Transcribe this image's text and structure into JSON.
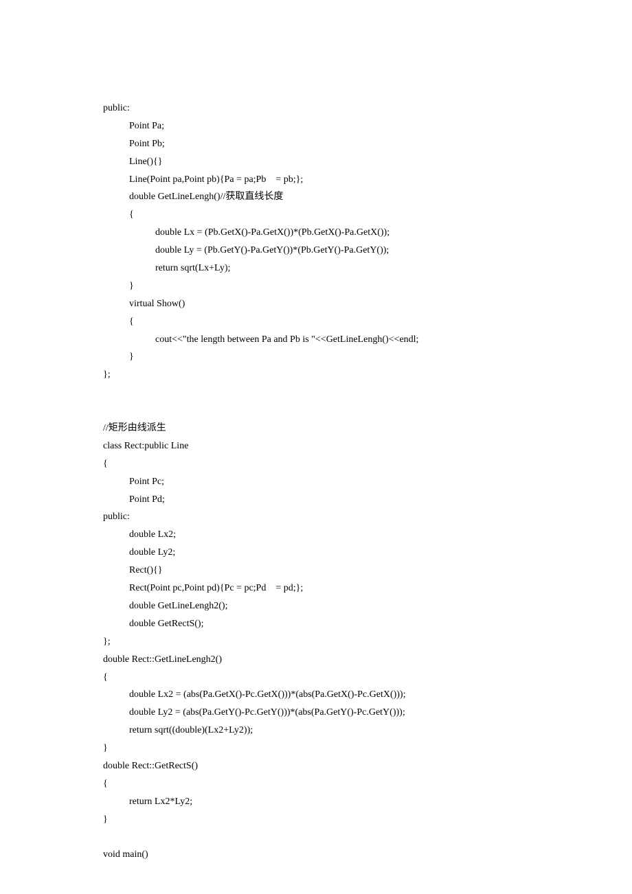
{
  "lines": [
    {
      "indent": 0,
      "text": "public:"
    },
    {
      "indent": 1,
      "text": "Point Pa;"
    },
    {
      "indent": 1,
      "text": "Point Pb;"
    },
    {
      "indent": 1,
      "text": "Line(){}"
    },
    {
      "indent": 1,
      "text": "Line(Point pa,Point pb){Pa = pa;Pb    = pb;};"
    },
    {
      "indent": 1,
      "text": "double GetLineLengh()//获取直线长度"
    },
    {
      "indent": 1,
      "text": "{"
    },
    {
      "indent": 2,
      "text": "double Lx = (Pb.GetX()-Pa.GetX())*(Pb.GetX()-Pa.GetX());"
    },
    {
      "indent": 2,
      "text": "double Ly = (Pb.GetY()-Pa.GetY())*(Pb.GetY()-Pa.GetY());"
    },
    {
      "indent": 2,
      "text": "return sqrt(Lx+Ly);"
    },
    {
      "indent": 1,
      "text": "}"
    },
    {
      "indent": 1,
      "text": "virtual Show()"
    },
    {
      "indent": 1,
      "text": "{"
    },
    {
      "indent": 2,
      "text": "cout<<\"the length between Pa and Pb is \"<<GetLineLengh()<<endl;"
    },
    {
      "indent": 1,
      "text": "}"
    },
    {
      "indent": 0,
      "text": "};"
    },
    {
      "indent": 0,
      "text": ""
    },
    {
      "indent": 0,
      "text": ""
    },
    {
      "indent": 0,
      "text": "//矩形由线派生"
    },
    {
      "indent": 0,
      "text": "class Rect:public Line"
    },
    {
      "indent": 0,
      "text": "{"
    },
    {
      "indent": 1,
      "text": "Point Pc;"
    },
    {
      "indent": 1,
      "text": "Point Pd;"
    },
    {
      "indent": 0,
      "text": "public:"
    },
    {
      "indent": 1,
      "text": "double Lx2;"
    },
    {
      "indent": 1,
      "text": "double Ly2;"
    },
    {
      "indent": 1,
      "text": "Rect(){}"
    },
    {
      "indent": 1,
      "text": "Rect(Point pc,Point pd){Pc = pc;Pd    = pd;};"
    },
    {
      "indent": 1,
      "text": "double GetLineLengh2();"
    },
    {
      "indent": 1,
      "text": "double GetRectS();"
    },
    {
      "indent": 0,
      "text": "};"
    },
    {
      "indent": 0,
      "text": "double Rect::GetLineLengh2()"
    },
    {
      "indent": 0,
      "text": "{"
    },
    {
      "indent": 1,
      "text": "double Lx2 = (abs(Pa.GetX()-Pc.GetX()))*(abs(Pa.GetX()-Pc.GetX()));"
    },
    {
      "indent": 1,
      "text": "double Ly2 = (abs(Pa.GetY()-Pc.GetY()))*(abs(Pa.GetY()-Pc.GetY()));"
    },
    {
      "indent": 1,
      "text": "return sqrt((double)(Lx2+Ly2));"
    },
    {
      "indent": 0,
      "text": "}"
    },
    {
      "indent": 0,
      "text": "double Rect::GetRectS()"
    },
    {
      "indent": 0,
      "text": "{"
    },
    {
      "indent": 1,
      "text": "return Lx2*Ly2;"
    },
    {
      "indent": 0,
      "text": "}"
    },
    {
      "indent": 0,
      "text": ""
    },
    {
      "indent": 0,
      "text": "void main()"
    }
  ]
}
